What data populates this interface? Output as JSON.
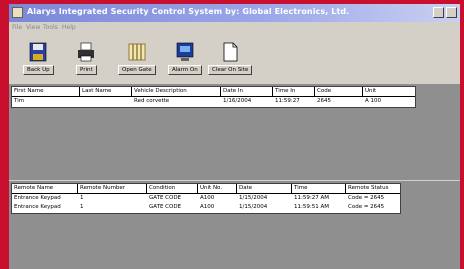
{
  "window": {
    "title": "Alarys Integrated Security Control System by: Global Electronics, Ltd."
  },
  "menu": [
    "File",
    "View",
    "Tools",
    "Help"
  ],
  "toolbar": [
    {
      "label": "Back Up",
      "icon": "floppy-disk-icon"
    },
    {
      "label": "Print",
      "icon": "printer-icon"
    },
    {
      "label": "Open Gate",
      "icon": "gate-icon"
    },
    {
      "label": "Alarm On",
      "icon": "alarm-monitor-icon"
    },
    {
      "label": "Clear On Site",
      "icon": "document-icon"
    }
  ],
  "onsite": {
    "columns": [
      "First Name",
      "Last Name",
      "Vehicle Description",
      "Date In",
      "Time In",
      "Code",
      "Unit"
    ],
    "rows": [
      [
        "Tim",
        "",
        "Red corvette",
        "1/16/2004",
        "11:59:27",
        "2645",
        "A 100"
      ]
    ]
  },
  "events": {
    "columns": [
      "Remote Name",
      "Remote Number",
      "Condition",
      "Unit No.",
      "Date",
      "Time",
      "Remote Status"
    ],
    "rows": [
      [
        "Entrance Keypad",
        "1",
        "GATE CODE",
        "A100",
        "1/15/2004",
        "11:59:27 AM",
        "Code = 2645"
      ],
      [
        "Entrance Keypad",
        "1",
        "GATE CODE",
        "A100",
        "1/15/2004",
        "11:59:51 AM",
        "Code = 2645"
      ]
    ]
  },
  "colors": {
    "background": "#c8102e",
    "window": "#d4d0c8",
    "titlebar": "#8a96e0"
  }
}
